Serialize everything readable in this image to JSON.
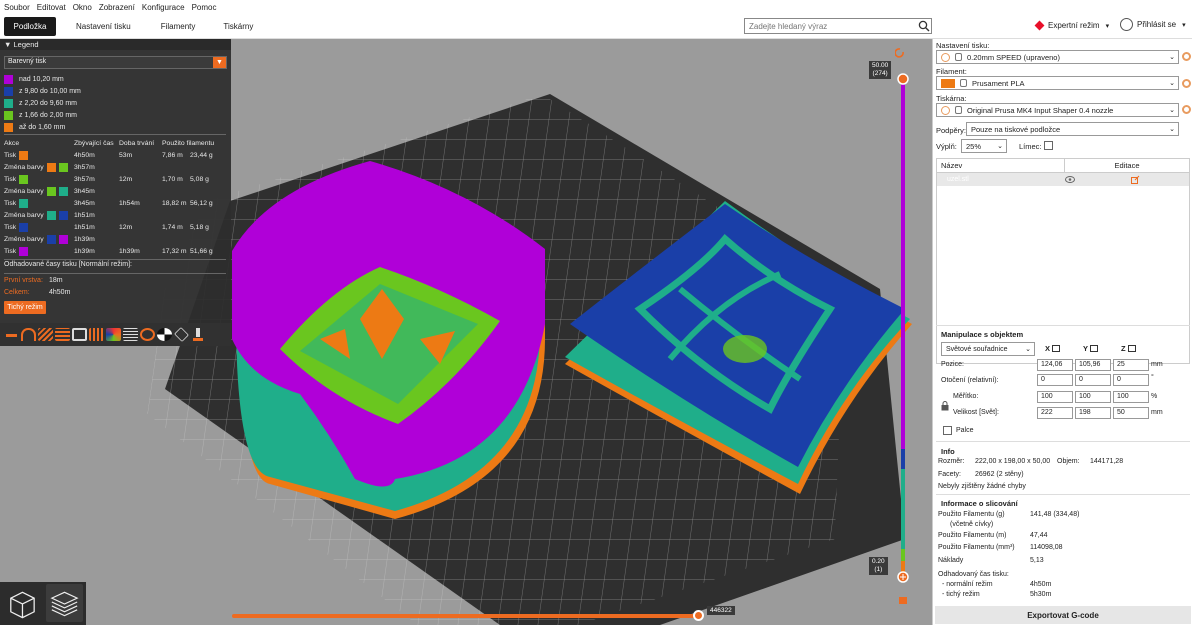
{
  "menu": [
    "Soubor",
    "Editovat",
    "Okno",
    "Zobrazení",
    "Konfigurace",
    "Pomoc"
  ],
  "tabs": [
    {
      "label": "Podložka",
      "active": true
    },
    {
      "label": "Nastavení tisku"
    },
    {
      "label": "Filamenty"
    },
    {
      "label": "Tiskárny"
    }
  ],
  "search": {
    "placeholder": "Zadejte hledaný výraz"
  },
  "header": {
    "expert": "Expertní režim",
    "login": "Přihlásit se"
  },
  "legend": {
    "title": "Legend",
    "mode": "Barevný tisk",
    "ranges": [
      {
        "label": "nad 10,20 mm",
        "color": "#b000d8"
      },
      {
        "label": "z 9,80 do 10,00 mm",
        "color": "#1a3fa8"
      },
      {
        "label": "z 2,20 do 9,60 mm",
        "color": "#1fae8a"
      },
      {
        "label": "z 1,66 do 2,00 mm",
        "color": "#6ac61f"
      },
      {
        "label": "až do 1,60 mm",
        "color": "#ed7a14"
      }
    ],
    "table_headers": [
      "Akce",
      "Zbývající čas",
      "Doba trvání",
      "Použito filamentu",
      ""
    ],
    "rows": [
      {
        "action": "Tisk",
        "colors": [
          "#ed7a14"
        ],
        "remaining": "4h50m",
        "duration": "53m",
        "m": "7,86 m",
        "g": "23,44 g"
      },
      {
        "action": "Změna barvy",
        "colors": [
          "#ed7a14",
          "#6ac61f"
        ],
        "remaining": "3h57m",
        "duration": "",
        "m": "",
        "g": ""
      },
      {
        "action": "Tisk",
        "colors": [
          "#6ac61f"
        ],
        "remaining": "3h57m",
        "duration": "12m",
        "m": "1,70 m",
        "g": "5,08 g"
      },
      {
        "action": "Změna barvy",
        "colors": [
          "#6ac61f",
          "#1fae8a"
        ],
        "remaining": "3h45m",
        "duration": "",
        "m": "",
        "g": ""
      },
      {
        "action": "Tisk",
        "colors": [
          "#1fae8a"
        ],
        "remaining": "3h45m",
        "duration": "1h54m",
        "m": "18,82 m",
        "g": "56,12 g"
      },
      {
        "action": "Změna barvy",
        "colors": [
          "#1fae8a",
          "#1a3fa8"
        ],
        "remaining": "1h51m",
        "duration": "",
        "m": "",
        "g": ""
      },
      {
        "action": "Tisk",
        "colors": [
          "#1a3fa8"
        ],
        "remaining": "1h51m",
        "duration": "12m",
        "m": "1,74 m",
        "g": "5,18 g"
      },
      {
        "action": "Změna barvy",
        "colors": [
          "#1a3fa8",
          "#b000d8"
        ],
        "remaining": "1h39m",
        "duration": "",
        "m": "",
        "g": ""
      },
      {
        "action": "Tisk",
        "colors": [
          "#b000d8"
        ],
        "remaining": "1h39m",
        "duration": "1h39m",
        "m": "17,32 m",
        "g": "51,66 g"
      }
    ],
    "estimate_title": "Odhadované časy tisku [Normální režim]:",
    "first_layer_label": "První vrstva:",
    "first_layer": "18m",
    "total_label": "Celkem:",
    "total": "4h50m",
    "quiet_button": "Tichý režim"
  },
  "slider": {
    "top_value": "50.00",
    "top_layer": "(274)",
    "bottom_value": "0.20",
    "bottom_layer": "(1)",
    "moves": "446322"
  },
  "panel": {
    "print_settings_label": "Nastavení tisku:",
    "print_settings": "0.20mm SPEED (upraveno)",
    "filament_label": "Filament:",
    "filament": "Prusament PLA",
    "filament_color": "#ed7a14",
    "printer_label": "Tiskárna:",
    "printer": "Original Prusa MK4 Input Shaper 0.4 nozzle",
    "supports_label": "Podpěry:",
    "supports": "Pouze na tiskové podložce",
    "infill_label": "Výplň:",
    "infill": "25%",
    "brim_label": "Límec:",
    "col_name": "Název",
    "col_edit": "Editace",
    "object_name": "uzel.stl",
    "manip_title": "Manipulace s objektem",
    "coord_mode": "Světové souřadnice",
    "axes": [
      "X",
      "Y",
      "Z"
    ],
    "position_label": "Pozice:",
    "position": [
      "124,06",
      "105,96",
      "25"
    ],
    "position_unit": "mm",
    "rotation_label": "Otočení (relativní):",
    "rotation": [
      "0",
      "0",
      "0"
    ],
    "rotation_unit": "°",
    "scale_label": "Měřítko:",
    "scale": [
      "100",
      "100",
      "100"
    ],
    "scale_unit": "%",
    "size_label": "Velikost [Svět]:",
    "size": [
      "222",
      "198",
      "50"
    ],
    "size_unit": "mm",
    "inches_label": "Palce",
    "info_title": "Info",
    "size_info_label": "Rozměr:",
    "size_info": "222,00 x 198,00 x 50,00",
    "volume_label": "Objem:",
    "volume": "144171,28",
    "facets_label": "Facety:",
    "facets": "26962 (2 stěny)",
    "errors": "Nebyly zjištěny žádné chyby",
    "slice_title": "Informace o slicování",
    "slice_rows": [
      {
        "label": "Použito Filamentu (g)",
        "value": "141,48 (334,48)"
      },
      {
        "label": "(včetně cívky)",
        "value": ""
      },
      {
        "label": "Použito Filamentu (m)",
        "value": "47,44"
      },
      {
        "label": "Použito Filamentu (mm³)",
        "value": "114098,08"
      },
      {
        "label": "Náklady",
        "value": "5,13"
      },
      {
        "label": "Odhadovaný čas tisku:",
        "value": ""
      },
      {
        "label": "- normální režim",
        "value": "4h50m"
      },
      {
        "label": "- tichý režim",
        "value": "5h30m"
      }
    ],
    "export": "Exportovat G-code"
  }
}
